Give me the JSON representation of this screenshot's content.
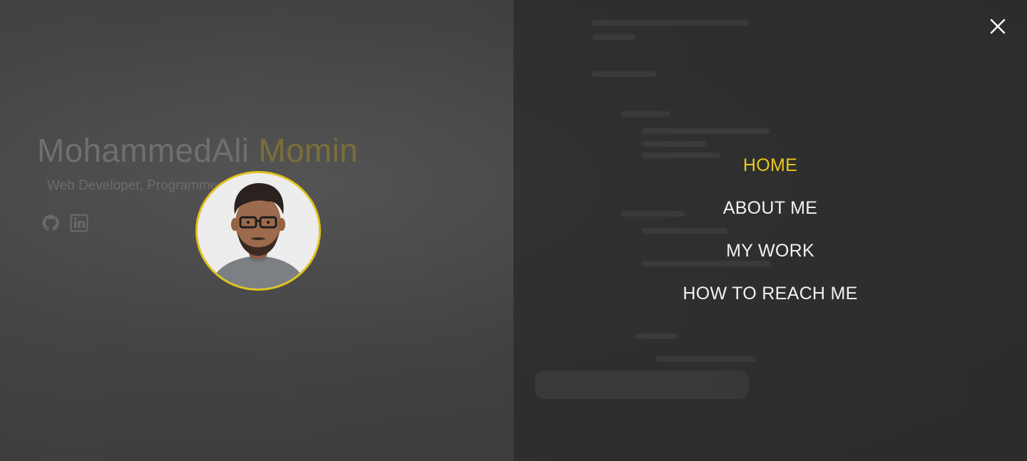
{
  "hero": {
    "first_name": "MohammedAli",
    "last_name": "Momin",
    "subtitle": "Web Developer, Programmer & Designer"
  },
  "social": [
    {
      "icon": "github-icon"
    },
    {
      "icon": "linkedin-icon"
    }
  ],
  "menu": {
    "items": [
      {
        "label": "HOME",
        "active": true
      },
      {
        "label": "ABOUT ME",
        "active": false
      },
      {
        "label": "MY WORK",
        "active": false
      },
      {
        "label": "HOW TO REACH ME",
        "active": false
      }
    ],
    "close_icon": "close-icon"
  },
  "colors": {
    "accent": "#e8c81a",
    "menu_text": "#f2f2f2",
    "panel": "#282828"
  }
}
